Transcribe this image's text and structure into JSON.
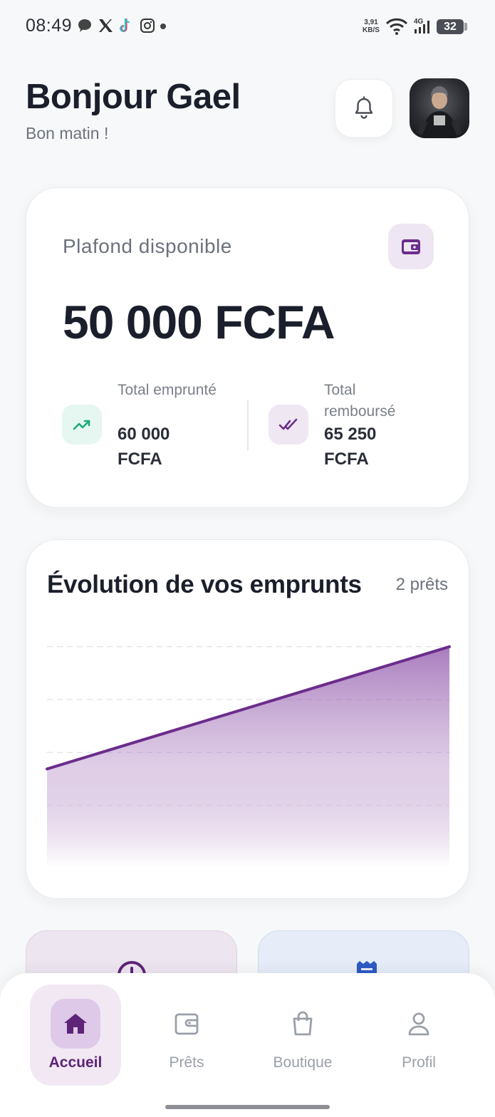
{
  "status_bar": {
    "time": "08:49",
    "net_speed_value": "3,91",
    "net_speed_unit": "KB/S",
    "network": "4G",
    "battery": "32"
  },
  "header": {
    "greeting": "Bonjour Gael",
    "subgreeting": "Bon matin !"
  },
  "plafond": {
    "label": "Plafond disponible",
    "amount": "50 000 FCFA",
    "borrowed_label": "Total emprunté",
    "borrowed_value": "60 000 FCFA",
    "repaid_label": "Total remboursé",
    "repaid_value": "65 250 FCFA"
  },
  "chart_card": {
    "title": "Évolution de vos emprunts",
    "count": "2 prêts"
  },
  "chart_data": {
    "type": "area",
    "title": "Évolution de vos emprunts",
    "x": [
      1,
      2
    ],
    "values": [
      0.42,
      0.94
    ],
    "ylim": [
      0,
      1
    ],
    "grid": true,
    "color": "#6b2d8c"
  },
  "nav": {
    "items": [
      {
        "label": "Accueil",
        "icon": "home-icon",
        "active": true
      },
      {
        "label": "Prêts",
        "icon": "wallet-icon",
        "active": false
      },
      {
        "label": "Boutique",
        "icon": "shopping-bag-icon",
        "active": false
      },
      {
        "label": "Profil",
        "icon": "user-icon",
        "active": false
      }
    ]
  },
  "colors": {
    "accent": "#6b2d8c",
    "accent_light": "#efe6f3",
    "green": "#1ea97c"
  }
}
